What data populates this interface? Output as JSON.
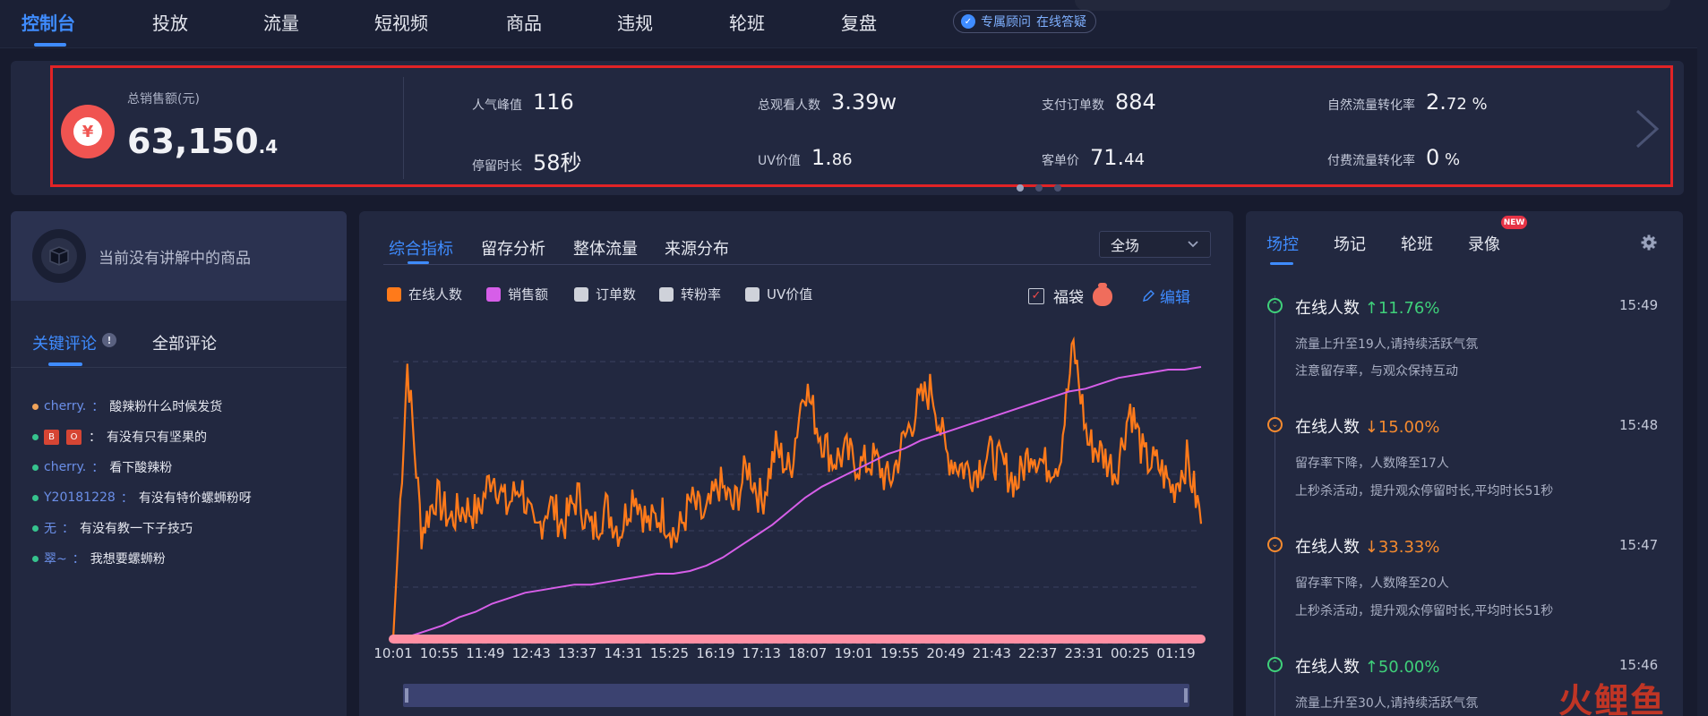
{
  "nav": {
    "items": [
      "控制台",
      "投放",
      "流量",
      "短视频",
      "商品",
      "违规",
      "轮班",
      "复盘"
    ],
    "active_index": 0,
    "advisor": {
      "label": "专属顾问",
      "status": "在线答疑"
    }
  },
  "summary": {
    "total_label": "总销售额(元)",
    "total_int": "63,150",
    "total_frac": ".4",
    "stats": [
      {
        "label": "人气峰值",
        "value": "116",
        "unit": ""
      },
      {
        "label": "总观看人数",
        "value": "3.39w",
        "unit": ""
      },
      {
        "label": "支付订单数",
        "value": "884",
        "unit": ""
      },
      {
        "label": "自然流量转化率",
        "value": "2.",
        "small": "72 %"
      },
      {
        "label": "停留时长",
        "value": "58秒",
        "unit": ""
      },
      {
        "label": "UV价值",
        "value": "1.",
        "small": "86"
      },
      {
        "label": "客单价",
        "value": "71.",
        "small": "44"
      },
      {
        "label": "付费流量转化率",
        "value": "0",
        "small": " %"
      }
    ],
    "carousel_dots": 3,
    "carousel_active": 0
  },
  "left": {
    "empty_product": "当前没有讲解中的商品",
    "tabs": [
      "关键评论",
      "全部评论"
    ],
    "info_icon": "!",
    "comments": [
      {
        "user": "cherry.",
        "sep": "：",
        "text": "酸辣粉什么时候发货",
        "dot": "#f0a35a"
      },
      {
        "user": "",
        "badges": [
          "B",
          "O"
        ],
        "sep": "：",
        "text": "有没有只有坚果的",
        "dot": "#36c38e"
      },
      {
        "user": "cherry.",
        "sep": "：",
        "text": "看下酸辣粉",
        "dot": "#36c38e"
      },
      {
        "user": "Y20181228",
        "sep": "：",
        "text": "有没有特价螺蛳粉呀",
        "dot": "#36c38e"
      },
      {
        "user": "无",
        "sep": "：",
        "text": "有没有教一下子技巧",
        "dot": "#36c38e"
      },
      {
        "user": "翠~",
        "sep": "：",
        "text": "我想要螺蛳粉",
        "dot": "#36c38e"
      }
    ]
  },
  "center": {
    "tabs": [
      "综合指标",
      "留存分析",
      "整体流量",
      "来源分布"
    ],
    "scope": "全场",
    "legend": [
      {
        "label": "在线人数",
        "color": "#ff7a1a"
      },
      {
        "label": "销售额",
        "color": "#d65ee8"
      },
      {
        "label": "订单数",
        "color": "#cfd2da"
      },
      {
        "label": "转粉率",
        "color": "#cfd2da"
      },
      {
        "label": "UV价值",
        "color": "#cfd2da"
      }
    ],
    "lucky_bag": "福袋",
    "edit": "编辑"
  },
  "chart_data": {
    "type": "line",
    "x": [
      "10:01",
      "10:55",
      "11:49",
      "12:43",
      "13:37",
      "14:31",
      "15:25",
      "16:19",
      "17:13",
      "18:07",
      "19:01",
      "19:55",
      "20:49",
      "21:43",
      "22:37",
      "23:31",
      "00:25",
      "01:19"
    ],
    "series": [
      {
        "name": "在线人数",
        "color": "#ff7a1a",
        "values": [
          0,
          92,
          36,
          48,
          40,
          44,
          42,
          56,
          44,
          52,
          34,
          46,
          38,
          48,
          36,
          44,
          36,
          50,
          38,
          42,
          34,
          46,
          40,
          52,
          44,
          58,
          46,
          64,
          56,
          86,
          70,
          60,
          62,
          58,
          60,
          52,
          66,
          78,
          84,
          62,
          58,
          56,
          62,
          58,
          52,
          64,
          58,
          60,
          98,
          66,
          62,
          56,
          78,
          60,
          58,
          50,
          60,
          40
        ]
      },
      {
        "name": "销售额",
        "color": "#d65ee8",
        "values": [
          0,
          1,
          3,
          5,
          8,
          10,
          13,
          15,
          17,
          18,
          19,
          20,
          20,
          21,
          22,
          23,
          24,
          24,
          25,
          27,
          30,
          34,
          38,
          42,
          47,
          52,
          56,
          59,
          62,
          65,
          68,
          70,
          73,
          75,
          77,
          79,
          81,
          83,
          85,
          87,
          89,
          91,
          92,
          94,
          96,
          97,
          98,
          99,
          99,
          100
        ]
      },
      {
        "name": "订单数",
        "color": "#ff8fa3",
        "values": []
      }
    ],
    "xlabel": "",
    "ylabel": "",
    "grid": true
  },
  "right": {
    "tabs": [
      "场控",
      "场记",
      "轮班",
      "录像"
    ],
    "new_badge": "NEW",
    "events": [
      {
        "dir": "up",
        "title": "在线人数",
        "change": "↑11.76%",
        "time": "15:49",
        "notes": [
          "流量上升至19人,请持续活跃气氛",
          "注意留存率，与观众保持互动"
        ]
      },
      {
        "dir": "down",
        "title": "在线人数",
        "change": "↓15.00%",
        "time": "15:48",
        "notes": [
          "留存率下降，人数降至17人",
          "上秒杀活动，提升观众停留时长,平均时长51秒"
        ]
      },
      {
        "dir": "down",
        "title": "在线人数",
        "change": "↓33.33%",
        "time": "15:47",
        "notes": [
          "留存率下降，人数降至20人",
          "上秒杀活动，提升观众停留时长,平均时长51秒"
        ]
      },
      {
        "dir": "up",
        "title": "在线人数",
        "change": "↑50.00%",
        "time": "15:46",
        "notes": [
          "流量上升至30人,请持续活跃气氛"
        ]
      }
    ],
    "colors": {
      "up": "#3fd07a",
      "down": "#f48a2f"
    }
  },
  "watermark": "火鲤鱼"
}
